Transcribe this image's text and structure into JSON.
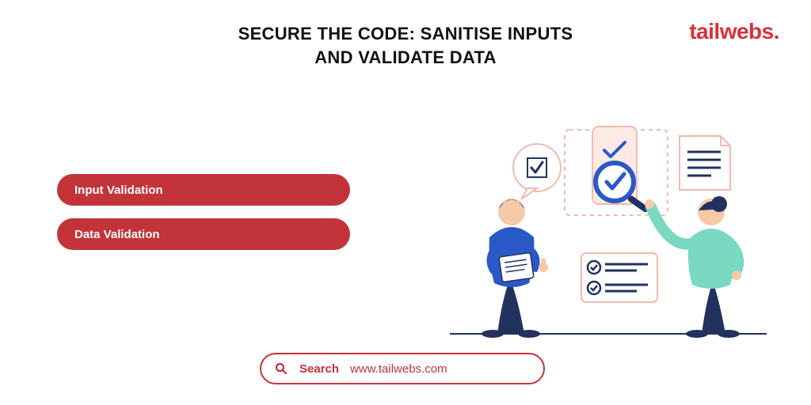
{
  "header": {
    "title_line1": "SECURE THE CODE: SANITISE INPUTS",
    "title_line2": "AND VALIDATE DATA",
    "brand": "tailwebs."
  },
  "pills": {
    "item1": "Input Validation",
    "item2": "Data Validation"
  },
  "search": {
    "label": "Search",
    "url": "www.tailwebs.com"
  },
  "colors": {
    "accent": "#c3333a",
    "blue": "#2a59c7",
    "teal": "#7ad9c0",
    "navy": "#22325f"
  }
}
